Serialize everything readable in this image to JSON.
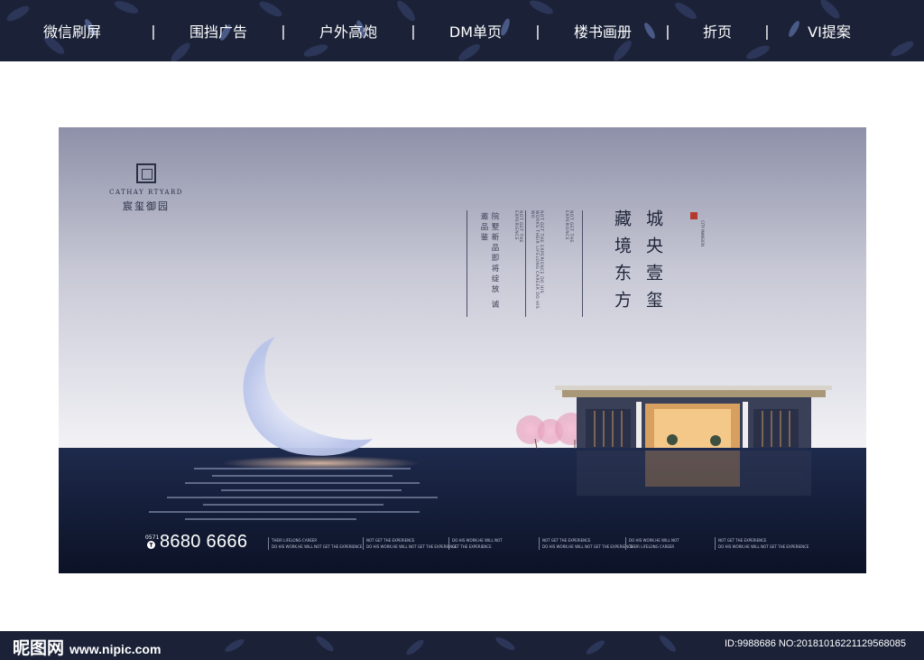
{
  "nav": {
    "items": [
      "微信刷屏",
      "围挡广告",
      "户外高炮",
      "DM单页",
      "楼书画册",
      "折页",
      "VI提案"
    ],
    "separator": "|"
  },
  "poster": {
    "logo_en": "CATHAY RTYARD",
    "logo_cn": "宸玺御园",
    "headline_right": "城央壹玺",
    "headline_left": "藏境东方",
    "city_label": "CITY MANSION",
    "vert_cn": "院墅新品即将绽放 诚邀品鉴",
    "vert_en_1": "NOT GET THE EXPERIENCE",
    "vert_en_2": "NOT GET THE EXPERIENCE DO HIS WORKS THEIR LIFELONG CAREER DO HIS WO",
    "vert_en_3": "NOT GET THE EXPERIENCE",
    "phone_area": "0571",
    "phone_icon": "phone-icon",
    "phone": "8680 6666",
    "tags": [
      {
        "l1": "THEIR LIFELONG CAREER",
        "l2": "DO HIS WORK.HE WILL NOT GET THE EXPERIENCE"
      },
      {
        "l1": "NOT GET THE EXPERIENCE",
        "l2": "DO HIS WORK.HE WILL NOT GET THE EXPERIENCE"
      },
      {
        "l1": "DO HIS WORK.HE WILL NOT",
        "l2": "GET THE EXPERIENCE"
      },
      {
        "l1": "NOT GET THE EXPERIENCE",
        "l2": "DO HIS WORK.HE WILL NOT GET THE EXPERIENCE"
      },
      {
        "l1": "DO HIS WORK.HE WILL NOT",
        "l2": "THEIR LIFELONG CAREER"
      },
      {
        "l1": "NOT GET THE EXPERIENCE",
        "l2": "DO HIS WORK.HE WILL NOT GET THE EXPERIENCE"
      }
    ]
  },
  "footer": {
    "brand": "昵图网",
    "url": "www.nipic.com",
    "id_text": "ID:9988686 NO:20181016221129568085"
  },
  "colors": {
    "bar_bg": "#1b2238",
    "sky_top": "#8d90a8",
    "sky_bottom": "#f0f0f4",
    "water": "#121a33",
    "seal": "#b53a2e",
    "blossom": "#e8a4c0"
  }
}
